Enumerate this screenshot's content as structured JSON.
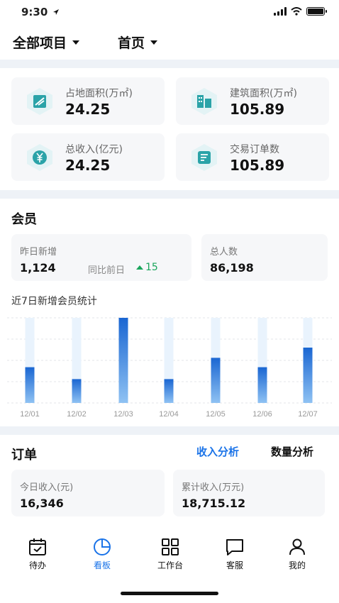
{
  "status_bar": {
    "time": "9:30"
  },
  "header": {
    "project_selector": "全部项目",
    "page_selector": "首页"
  },
  "stats": [
    {
      "label": "占地面积(万㎡)",
      "value": "24.25",
      "icon": "land-area-icon"
    },
    {
      "label": "建筑面积(万㎡)",
      "value": "105.89",
      "icon": "building-area-icon"
    },
    {
      "label": "总收入(亿元)",
      "value": "24.25",
      "icon": "yuan-income-icon"
    },
    {
      "label": "交易订单数",
      "value": "105.89",
      "icon": "order-count-icon"
    }
  ],
  "members": {
    "title": "会员",
    "yesterday_label": "昨日新增",
    "yesterday_value": "1,124",
    "compare_label": "同比前日",
    "compare_value": "15",
    "total_label": "总人数",
    "total_value": "86,198"
  },
  "chart_data": {
    "type": "bar",
    "title": "近7日新增会员统计",
    "categories": [
      "12/01",
      "12/02",
      "12/03",
      "12/04",
      "12/05",
      "12/06",
      "12/07"
    ],
    "values": [
      42,
      28,
      100,
      28,
      53,
      42,
      65
    ],
    "ylim": [
      0,
      100
    ],
    "grid": true,
    "colors": {
      "bar": "#1f6fd6",
      "track": "#e9f3fd"
    }
  },
  "orders": {
    "title": "订单",
    "tab_income": "收入分析",
    "tab_quantity": "数量分析",
    "today_label": "今日收入(元)",
    "today_value": "16,346",
    "total_label": "累计收入(万元)",
    "total_value": "18,715.12"
  },
  "nav": {
    "items": [
      {
        "label": "待办",
        "icon": "calendar-check-icon"
      },
      {
        "label": "看板",
        "icon": "pie-chart-icon"
      },
      {
        "label": "工作台",
        "icon": "grid-icon"
      },
      {
        "label": "客服",
        "icon": "chat-bubble-icon"
      },
      {
        "label": "我的",
        "icon": "user-icon"
      }
    ],
    "active_index": 1
  },
  "colors": {
    "accent": "#1a73e8",
    "positive": "#1aa55c",
    "divider": "#eef2f7",
    "card": "#f6f7f9"
  }
}
